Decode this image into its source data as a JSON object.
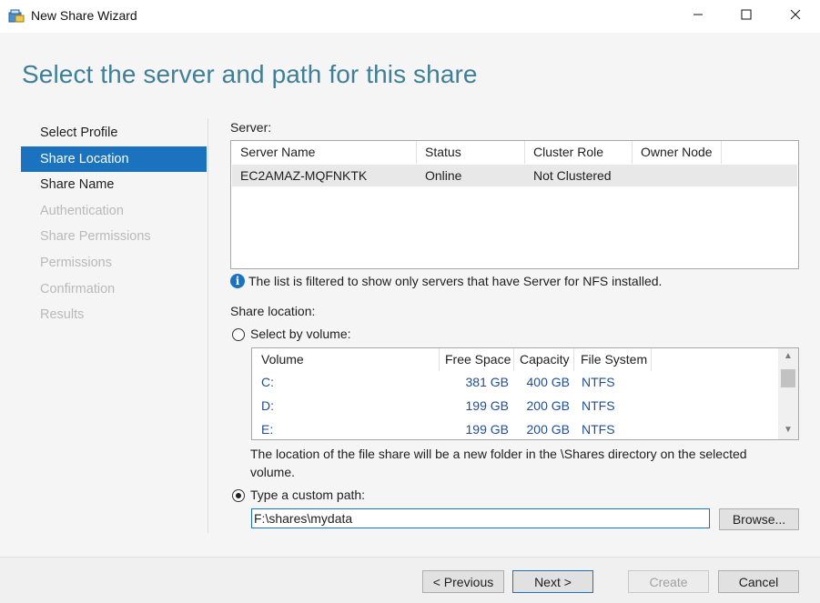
{
  "window": {
    "title": "New Share Wizard",
    "controls": {
      "minimize": "minimize-icon",
      "maximize": "maximize-icon",
      "close": "close-icon"
    }
  },
  "page": {
    "heading": "Select the server and path for this share"
  },
  "nav": {
    "items": [
      {
        "label": "Select Profile",
        "state": "normal"
      },
      {
        "label": "Share Location",
        "state": "active"
      },
      {
        "label": "Share Name",
        "state": "normal"
      },
      {
        "label": "Authentication",
        "state": "disabled"
      },
      {
        "label": "Share Permissions",
        "state": "disabled"
      },
      {
        "label": "Permissions",
        "state": "disabled"
      },
      {
        "label": "Confirmation",
        "state": "disabled"
      },
      {
        "label": "Results",
        "state": "disabled"
      }
    ]
  },
  "server": {
    "label": "Server:",
    "columns": [
      "Server Name",
      "Status",
      "Cluster Role",
      "Owner Node"
    ],
    "rows": [
      {
        "name": "EC2AMAZ-MQFNKTK",
        "status": "Online",
        "cluster_role": "Not Clustered",
        "owner_node": ""
      }
    ],
    "info": "The list is filtered to show only servers that have Server for NFS installed."
  },
  "share_location": {
    "label": "Share location:",
    "by_volume_label": "Select by volume:",
    "by_volume_selected": false,
    "volume_columns": [
      "Volume",
      "Free Space",
      "Capacity",
      "File System"
    ],
    "volumes": [
      {
        "volume": "C:",
        "free": "381 GB",
        "capacity": "400 GB",
        "fs": "NTFS"
      },
      {
        "volume": "D:",
        "free": "199 GB",
        "capacity": "200 GB",
        "fs": "NTFS"
      },
      {
        "volume": "E:",
        "free": "199 GB",
        "capacity": "200 GB",
        "fs": "NTFS"
      }
    ],
    "note": "The location of the file share will be a new folder in the \\Shares directory on the selected volume.",
    "custom_path_label": "Type a custom path:",
    "custom_path_selected": true,
    "custom_path_value": "F:\\shares\\mydata",
    "browse_label": "Browse..."
  },
  "footer": {
    "previous": "< Previous",
    "next": "Next >",
    "create": "Create",
    "cancel": "Cancel"
  },
  "colors": {
    "accent": "#1b72be",
    "heading": "#3f7f97",
    "disabled_text": "#b9b9b9"
  }
}
